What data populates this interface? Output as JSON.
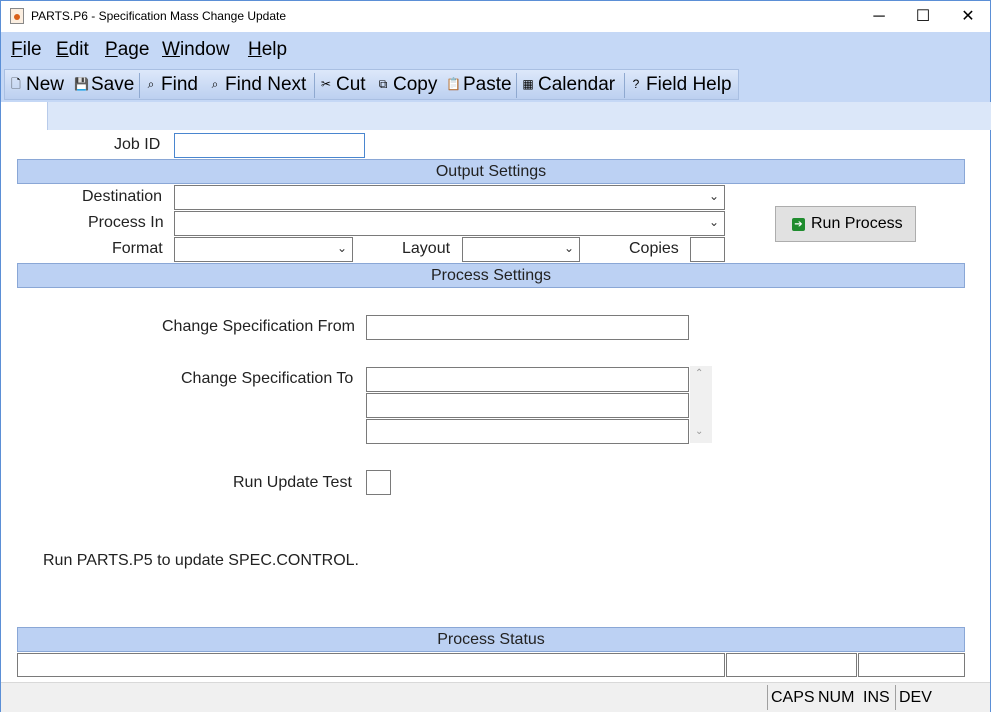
{
  "window": {
    "title": "PARTS.P6 - Specification Mass Change Update",
    "minimize": "─",
    "maximize": "☐",
    "close": "✕"
  },
  "menu": {
    "items": [
      {
        "u": "F",
        "rest": "ile"
      },
      {
        "u": "E",
        "rest": "dit"
      },
      {
        "u": "P",
        "rest": "age"
      },
      {
        "u": "W",
        "rest": "indow"
      },
      {
        "u": "H",
        "rest": "elp"
      }
    ]
  },
  "toolbar": {
    "new": "New",
    "save": "Save",
    "find": "Find",
    "find_next": "Find Next",
    "cut": "Cut",
    "copy": "Copy",
    "paste": "Paste",
    "calendar": "Calendar",
    "field_help": "Field Help"
  },
  "form": {
    "job_id_label": "Job ID",
    "job_id_value": "",
    "output_settings": "Output Settings",
    "destination_label": "Destination",
    "process_in_label": "Process In",
    "format_label": "Format",
    "layout_label": "Layout",
    "copies_label": "Copies",
    "run_process": "Run Process",
    "process_settings": "Process Settings",
    "change_from_label": "Change Specification From",
    "change_to_label": "Change Specification To",
    "run_update_test_label": "Run Update Test",
    "note": "Run PARTS.P5 to update SPEC.CONTROL.",
    "process_status": "Process Status"
  },
  "statusbar": {
    "caps": "CAPS",
    "num": "NUM",
    "ins": "INS",
    "dev": "DEV"
  }
}
